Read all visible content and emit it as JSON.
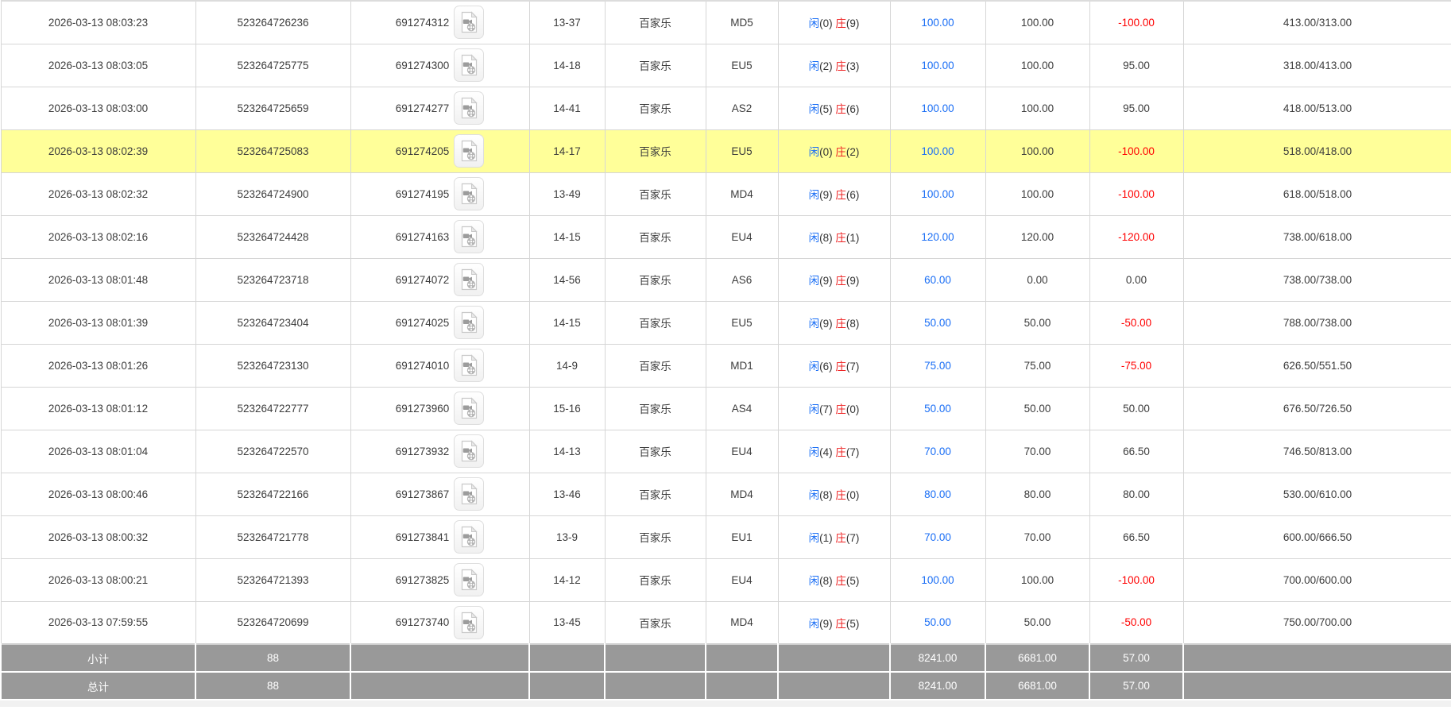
{
  "colors": {
    "accent_blue": "#1a6ef5",
    "accent_red": "#ff0000",
    "banker_red": "#ee2222",
    "highlight_yellow": "#ffff99",
    "footer_gray": "#999999",
    "border_gray": "#d6d6d6"
  },
  "table": {
    "rows": [
      {
        "time": "2026-03-13 08:03:23",
        "bet_id": "523264726236",
        "round_id": "691274312",
        "table_round": "13-37",
        "game": "百家乐",
        "table_code": "MD5",
        "player_label": "闲",
        "player_count": "(0)",
        "banker_label": "庄",
        "banker_count": "(9)",
        "bet_amount": "100.00",
        "valid_amount": "100.00",
        "winloss": "-100.00",
        "balance": "413.00/313.00",
        "highlighted": false
      },
      {
        "time": "2026-03-13 08:03:05",
        "bet_id": "523264725775",
        "round_id": "691274300",
        "table_round": "14-18",
        "game": "百家乐",
        "table_code": "EU5",
        "player_label": "闲",
        "player_count": "(2)",
        "banker_label": "庄",
        "banker_count": "(3)",
        "bet_amount": "100.00",
        "valid_amount": "100.00",
        "winloss": "95.00",
        "balance": "318.00/413.00",
        "highlighted": false
      },
      {
        "time": "2026-03-13 08:03:00",
        "bet_id": "523264725659",
        "round_id": "691274277",
        "table_round": "14-41",
        "game": "百家乐",
        "table_code": "AS2",
        "player_label": "闲",
        "player_count": "(5)",
        "banker_label": "庄",
        "banker_count": "(6)",
        "bet_amount": "100.00",
        "valid_amount": "100.00",
        "winloss": "95.00",
        "balance": "418.00/513.00",
        "highlighted": false
      },
      {
        "time": "2026-03-13 08:02:39",
        "bet_id": "523264725083",
        "round_id": "691274205",
        "table_round": "14-17",
        "game": "百家乐",
        "table_code": "EU5",
        "player_label": "闲",
        "player_count": "(0)",
        "banker_label": "庄",
        "banker_count": "(2)",
        "bet_amount": "100.00",
        "valid_amount": "100.00",
        "winloss": "-100.00",
        "balance": "518.00/418.00",
        "highlighted": true
      },
      {
        "time": "2026-03-13 08:02:32",
        "bet_id": "523264724900",
        "round_id": "691274195",
        "table_round": "13-49",
        "game": "百家乐",
        "table_code": "MD4",
        "player_label": "闲",
        "player_count": "(9)",
        "banker_label": "庄",
        "banker_count": "(6)",
        "bet_amount": "100.00",
        "valid_amount": "100.00",
        "winloss": "-100.00",
        "balance": "618.00/518.00",
        "highlighted": false
      },
      {
        "time": "2026-03-13 08:02:16",
        "bet_id": "523264724428",
        "round_id": "691274163",
        "table_round": "14-15",
        "game": "百家乐",
        "table_code": "EU4",
        "player_label": "闲",
        "player_count": "(8)",
        "banker_label": "庄",
        "banker_count": "(1)",
        "bet_amount": "120.00",
        "valid_amount": "120.00",
        "winloss": "-120.00",
        "balance": "738.00/618.00",
        "highlighted": false
      },
      {
        "time": "2026-03-13 08:01:48",
        "bet_id": "523264723718",
        "round_id": "691274072",
        "table_round": "14-56",
        "game": "百家乐",
        "table_code": "AS6",
        "player_label": "闲",
        "player_count": "(9)",
        "banker_label": "庄",
        "banker_count": "(9)",
        "bet_amount": "60.00",
        "valid_amount": "0.00",
        "winloss": "0.00",
        "balance": "738.00/738.00",
        "highlighted": false
      },
      {
        "time": "2026-03-13 08:01:39",
        "bet_id": "523264723404",
        "round_id": "691274025",
        "table_round": "14-15",
        "game": "百家乐",
        "table_code": "EU5",
        "player_label": "闲",
        "player_count": "(9)",
        "banker_label": "庄",
        "banker_count": "(8)",
        "bet_amount": "50.00",
        "valid_amount": "50.00",
        "winloss": "-50.00",
        "balance": "788.00/738.00",
        "highlighted": false
      },
      {
        "time": "2026-03-13 08:01:26",
        "bet_id": "523264723130",
        "round_id": "691274010",
        "table_round": "14-9",
        "game": "百家乐",
        "table_code": "MD1",
        "player_label": "闲",
        "player_count": "(6)",
        "banker_label": "庄",
        "banker_count": "(7)",
        "bet_amount": "75.00",
        "valid_amount": "75.00",
        "winloss": "-75.00",
        "balance": "626.50/551.50",
        "highlighted": false
      },
      {
        "time": "2026-03-13 08:01:12",
        "bet_id": "523264722777",
        "round_id": "691273960",
        "table_round": "15-16",
        "game": "百家乐",
        "table_code": "AS4",
        "player_label": "闲",
        "player_count": "(7)",
        "banker_label": "庄",
        "banker_count": "(0)",
        "bet_amount": "50.00",
        "valid_amount": "50.00",
        "winloss": "50.00",
        "balance": "676.50/726.50",
        "highlighted": false
      },
      {
        "time": "2026-03-13 08:01:04",
        "bet_id": "523264722570",
        "round_id": "691273932",
        "table_round": "14-13",
        "game": "百家乐",
        "table_code": "EU4",
        "player_label": "闲",
        "player_count": "(4)",
        "banker_label": "庄",
        "banker_count": "(7)",
        "bet_amount": "70.00",
        "valid_amount": "70.00",
        "winloss": "66.50",
        "balance": "746.50/813.00",
        "highlighted": false
      },
      {
        "time": "2026-03-13 08:00:46",
        "bet_id": "523264722166",
        "round_id": "691273867",
        "table_round": "13-46",
        "game": "百家乐",
        "table_code": "MD4",
        "player_label": "闲",
        "player_count": "(8)",
        "banker_label": "庄",
        "banker_count": "(0)",
        "bet_amount": "80.00",
        "valid_amount": "80.00",
        "winloss": "80.00",
        "balance": "530.00/610.00",
        "highlighted": false
      },
      {
        "time": "2026-03-13 08:00:32",
        "bet_id": "523264721778",
        "round_id": "691273841",
        "table_round": "13-9",
        "game": "百家乐",
        "table_code": "EU1",
        "player_label": "闲",
        "player_count": "(1)",
        "banker_label": "庄",
        "banker_count": "(7)",
        "bet_amount": "70.00",
        "valid_amount": "70.00",
        "winloss": "66.50",
        "balance": "600.00/666.50",
        "highlighted": false
      },
      {
        "time": "2026-03-13 08:00:21",
        "bet_id": "523264721393",
        "round_id": "691273825",
        "table_round": "14-12",
        "game": "百家乐",
        "table_code": "EU4",
        "player_label": "闲",
        "player_count": "(8)",
        "banker_label": "庄",
        "banker_count": "(5)",
        "bet_amount": "100.00",
        "valid_amount": "100.00",
        "winloss": "-100.00",
        "balance": "700.00/600.00",
        "highlighted": false
      },
      {
        "time": "2026-03-13 07:59:55",
        "bet_id": "523264720699",
        "round_id": "691273740",
        "table_round": "13-45",
        "game": "百家乐",
        "table_code": "MD4",
        "player_label": "闲",
        "player_count": "(9)",
        "banker_label": "庄",
        "banker_count": "(5)",
        "bet_amount": "50.00",
        "valid_amount": "50.00",
        "winloss": "-50.00",
        "balance": "750.00/700.00",
        "highlighted": false
      }
    ],
    "footer": {
      "subtotal_label": "小计",
      "total_label": "总计",
      "subtotal_count": "88",
      "total_count": "88",
      "subtotal_bet": "8241.00",
      "total_bet": "8241.00",
      "subtotal_valid": "6681.00",
      "total_valid": "6681.00",
      "subtotal_winloss": "57.00",
      "total_winloss": "57.00"
    }
  }
}
